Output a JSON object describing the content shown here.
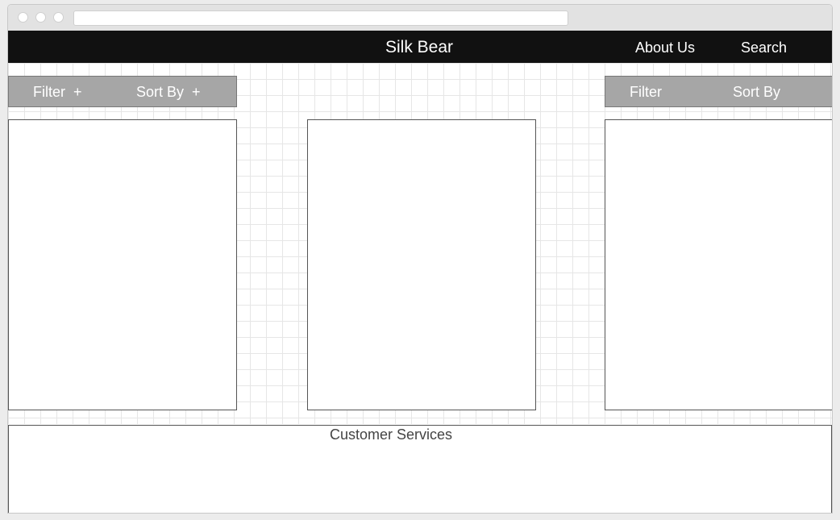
{
  "navbar": {
    "brand": "Silk Bear",
    "about_label": "About Us",
    "search_label": "Search"
  },
  "left_toolbar": {
    "filter_label": "Filter  +",
    "sort_label": "Sort By  +"
  },
  "right_toolbar": {
    "filter_label": "Filter",
    "sort_label": "Sort By"
  },
  "footer": {
    "title": "Customer Services"
  },
  "colors": {
    "navbar_bg": "#111111",
    "toolbar_bg": "#a6a6a6",
    "grid_line": "#e6e6e6"
  }
}
